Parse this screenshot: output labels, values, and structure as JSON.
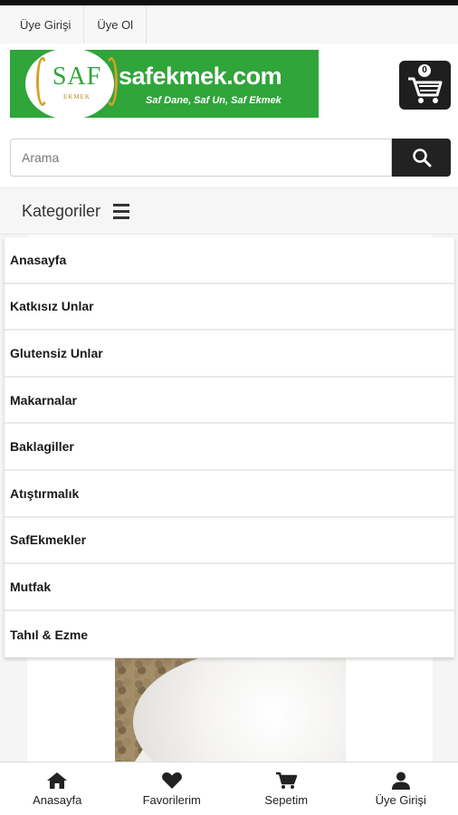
{
  "top_links": [
    "Üye Girişi",
    "Üye Ol"
  ],
  "logo": {
    "mark": "SAF",
    "mark_sub": "EKMEK",
    "domain": "safekmek.com",
    "slogan": "Saf Dane, Saf Un, Saf Ekmek"
  },
  "cart": {
    "count": "0"
  },
  "search": {
    "placeholder": "Arama"
  },
  "categories": {
    "title": "Kategoriler",
    "items": [
      "Anasayfa",
      "Katkısız Unlar",
      "Glutensiz Unlar",
      "Makarnalar",
      "Baklagiller",
      "Atıştırmalık",
      "SafEkmekler",
      "Mutfak",
      "Tahıl & Ezme"
    ]
  },
  "bottom_nav": [
    {
      "label": "Anasayfa",
      "icon": "home-icon"
    },
    {
      "label": "Favorilerim",
      "icon": "heart-icon"
    },
    {
      "label": "Sepetim",
      "icon": "cart-icon"
    },
    {
      "label": "Üye Girişi",
      "icon": "user-icon"
    }
  ],
  "colors": {
    "brand_green": "#2fa53a",
    "dark": "#222222"
  }
}
